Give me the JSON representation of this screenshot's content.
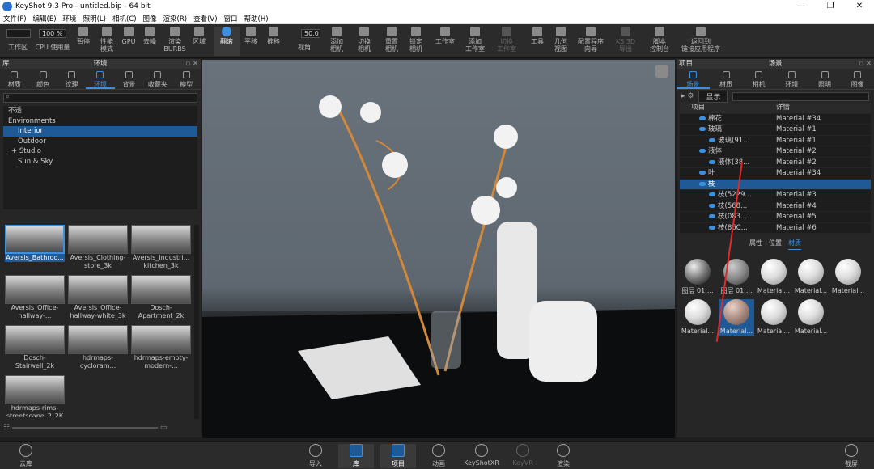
{
  "window": {
    "title": "KeyShot 9.3 Pro - untitled.bip - 64 bit",
    "min": "—",
    "max": "❐",
    "close": "✕"
  },
  "menu": [
    "文件(F)",
    "编辑(E)",
    "环境",
    "照明(L)",
    "相机(C)",
    "图像",
    "渲染(R)",
    "查看(V)",
    "窗口",
    "帮助(H)"
  ],
  "toolbar": {
    "cpu_value": "100 %",
    "fov_value": "50.0",
    "items": [
      {
        "label": "工作区"
      },
      {
        "label": "CPU 使用量"
      },
      {
        "label": "暂停"
      },
      {
        "label": "性能\n模式"
      },
      {
        "label": "GPU"
      },
      {
        "label": "去噪"
      },
      {
        "label": "渲染\nBURBS"
      },
      {
        "label": "区域"
      },
      {
        "label": "翻滚"
      },
      {
        "label": "平移"
      },
      {
        "label": "推移"
      },
      {
        "label": "视角"
      },
      {
        "label": "添加\n相机"
      },
      {
        "label": "切换\n相机"
      },
      {
        "label": "重置\n相机"
      },
      {
        "label": "锁定\n相机"
      },
      {
        "label": "工作室"
      },
      {
        "label": "添加\n工作室"
      },
      {
        "label": "切换\n工作室"
      },
      {
        "label": "工具"
      },
      {
        "label": "几何\n视图"
      },
      {
        "label": "配置程序\n向导"
      },
      {
        "label": "KS 3D\n导出"
      },
      {
        "label": "脚本\n控制台"
      },
      {
        "label": "返回到\n链接应用程序"
      }
    ]
  },
  "left": {
    "header": "库",
    "title": "环境",
    "tabs": [
      "材质",
      "颜色",
      "纹理",
      "环境",
      "背景",
      "收藏夹",
      "模型"
    ],
    "tree": [
      "不透",
      "Environments",
      "Interior",
      "Outdoor",
      "+ Studio",
      "Sun & Sky"
    ],
    "thumbs": [
      "Aversis_Bathroo...",
      "Aversis_Clothing-\nstore_3k",
      "Aversis_Industri...\nkitchen_3k",
      "Aversis_Office-\nhallway-...",
      "Aversis_Office-\nhallway-white_3k",
      "Dosch-\nApartment_2k",
      "Dosch-\nStairwell_2k",
      "hdrmaps-\ncycloram...",
      "hdrmaps-empty-\nmodern-...",
      "hdrmaps-rims-\nstreetscape_2_2K"
    ]
  },
  "right": {
    "header": "项目",
    "title": "场景",
    "tabs": [
      "场景",
      "材质",
      "相机",
      "环境",
      "照明",
      "图像"
    ],
    "show_label": "显示",
    "col_item": "项目",
    "col_detail": "详情",
    "rows": [
      {
        "name": "棉花",
        "detail": "Material #34"
      },
      {
        "name": "玻璃",
        "detail": "Material #1"
      },
      {
        "name": "玻璃(91...",
        "detail": "Material #1"
      },
      {
        "name": "液体",
        "detail": "Material #2"
      },
      {
        "name": "液体(38...",
        "detail": "Material #2"
      },
      {
        "name": "叶",
        "detail": "Material #34"
      },
      {
        "name": "枝",
        "detail": ""
      },
      {
        "name": "枝(5229...",
        "detail": "Material #3"
      },
      {
        "name": "枝(568...",
        "detail": "Material #4"
      },
      {
        "name": "枝(083...",
        "detail": "Material #5"
      },
      {
        "name": "枝(86C...",
        "detail": "Material #6"
      }
    ],
    "subtabs": [
      "属性",
      "位置",
      "材质"
    ],
    "mats": [
      "图层 01:...",
      "图层 01:...",
      "Material...",
      "Material...",
      "Material...",
      "Material...",
      "Material...",
      "Material...",
      "Material..."
    ]
  },
  "bottom": {
    "items": [
      "云库",
      "导入",
      "库",
      "项目",
      "动画",
      "KeyShotXR",
      "KeyVR",
      "渲染",
      "截屏"
    ]
  }
}
